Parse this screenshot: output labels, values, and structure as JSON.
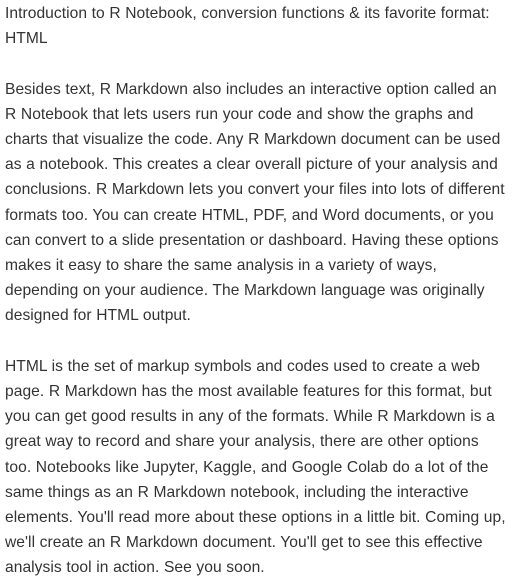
{
  "document": {
    "heading": "Introduction to R Notebook, conversion functions & its favorite format: HTML",
    "paragraphs": [
      "Besides text, R Markdown also includes an interactive option called an R Notebook that lets users run your code and show the graphs and charts that visualize the code. Any R Markdown document can be used as a notebook. This creates a clear overall picture of your analysis and conclusions. R Markdown lets you convert your files into lots of different formats too. You can create HTML, PDF, and Word documents, or you can convert to a slide presentation or dashboard. Having these options makes it easy to share the same analysis in a variety of ways, depending on your audience. The Markdown language was originally designed for HTML output.",
      "HTML is the set of markup symbols and codes used to create a web page. R Markdown has the most available features for this format, but you can get good results in any of the formats. While R Markdown is a great way to record and share your analysis, there are other options too. Notebooks like Jupyter, Kaggle, and Google Colab do a lot of the same things as an R Markdown notebook, including the interactive elements. You'll read more about these options in a little bit. Coming up, we'll create an R Markdown document. You'll get to see this effective analysis tool in action. See you soon."
    ]
  }
}
